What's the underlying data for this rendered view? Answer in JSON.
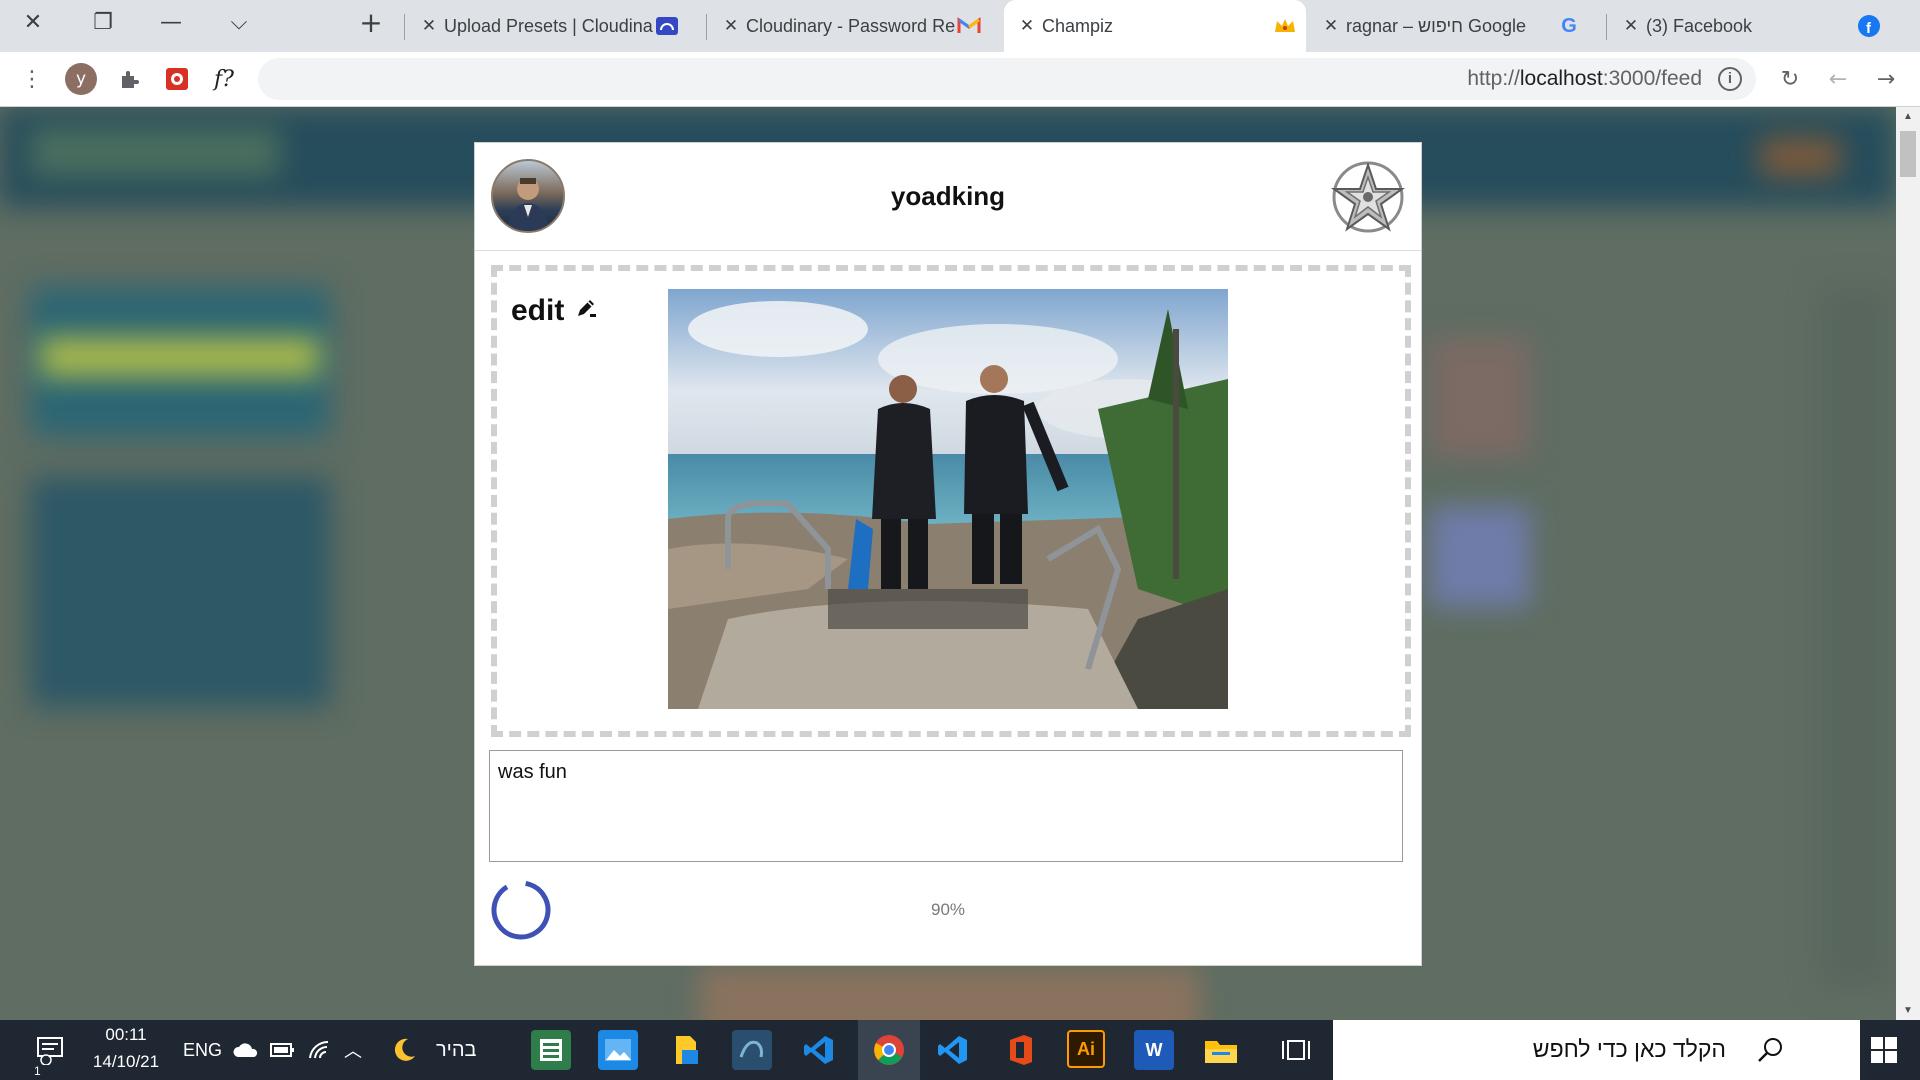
{
  "browser": {
    "tabs": [
      {
        "title": "Upload Presets | Cloudinary",
        "icon": "cloudinary-icon",
        "active": false
      },
      {
        "title": "Cloudinary - Password Reset",
        "icon": "gmail-icon",
        "active": false
      },
      {
        "title": "Champiz",
        "icon": "crown-icon",
        "active": true
      },
      {
        "title": "ragnar – חיפוש Google",
        "icon": "google-icon",
        "active": false
      },
      {
        "title": "(3) Facebook",
        "icon": "facebook-icon",
        "active": false
      }
    ],
    "profile_initial": "y",
    "url": {
      "scheme": "http://",
      "host": "localhost",
      "rest": ":3000/feed"
    },
    "ext_label": "f?"
  },
  "post": {
    "username": "yoadking",
    "edit_label": "edit",
    "caption": "was fun",
    "progress_text": "90%",
    "progress_value": 0.9
  },
  "taskbar": {
    "time": "00:11",
    "date": "14/10/21",
    "language": "ENG",
    "theme_label": "בהיר",
    "search_placeholder": "הקלד כאן כדי לחפש",
    "notification_count": "1",
    "apps": [
      "sheets-icon",
      "photos-icon",
      "files-icon",
      "mysql-icon",
      "vscode-icon",
      "chrome-icon",
      "vscode-icon-2",
      "office-icon",
      "illustrator-icon",
      "word-icon",
      "explorer-icon"
    ],
    "illustrator_label": "Ai",
    "word_label": "W"
  },
  "colors": {
    "spinner": "#3f51b5",
    "taskbar": "#1f2733",
    "tabbar": "#dee1e6"
  }
}
